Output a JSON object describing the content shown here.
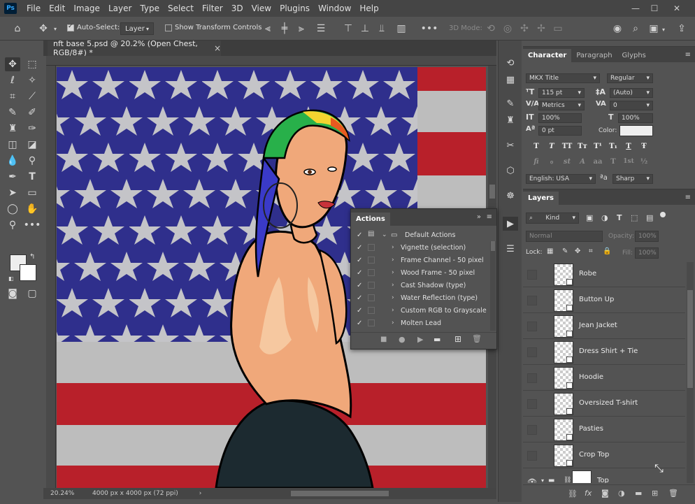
{
  "menubar": {
    "app_logo": "Ps",
    "items": [
      "File",
      "Edit",
      "Image",
      "Layer",
      "Type",
      "Select",
      "Filter",
      "3D",
      "View",
      "Plugins",
      "Window",
      "Help"
    ],
    "window_controls": [
      "—",
      "☐",
      "✕"
    ]
  },
  "options": {
    "auto_select_label": "Auto-Select:",
    "auto_select_checked": true,
    "auto_select_target": "Layer",
    "show_transform_label": "Show Transform Controls",
    "show_transform_checked": false,
    "mode_3d_label": "3D Mode:"
  },
  "document": {
    "tab_title": "nft base 5.psd @ 20.2% (Open Chest, RGB/8#) *",
    "close_glyph": "×",
    "zoom": "20.24%",
    "doc_size": "4000 px x 4000 px (72 ppi)"
  },
  "character": {
    "tabs": [
      "Character",
      "Paragraph",
      "Glyphs"
    ],
    "font_family": "MKX Title",
    "font_style": "Regular",
    "font_size": "115 pt",
    "leading": "(Auto)",
    "kerning": "Metrics",
    "tracking": "0",
    "vertical_scale": "100%",
    "horizontal_scale": "100%",
    "baseline_shift": "0 pt",
    "color_label": "Color:",
    "color_value": "#eeeeee",
    "language": "English: USA",
    "antialias": "Sharp",
    "style_buttons_row1": [
      "T",
      "T",
      "TT",
      "Tт",
      "T¹",
      "T₁",
      "T",
      "Ŧ"
    ],
    "style_buttons_row2": [
      "fi",
      "ℴ",
      "st",
      "A",
      "aa",
      "T",
      "1st",
      "½"
    ]
  },
  "layers": {
    "title": "Layers",
    "filter_kind": "Kind",
    "blend_mode": "Normal",
    "opacity_label": "Opacity:",
    "opacity_value": "100%",
    "lock_label": "Lock:",
    "fill_label": "Fill:",
    "fill_value": "100%",
    "items": [
      {
        "name": "Robe",
        "visible": false
      },
      {
        "name": "Button Up",
        "visible": false
      },
      {
        "name": "Jean Jacket",
        "visible": false
      },
      {
        "name": "Dress Shirt + Tie",
        "visible": false
      },
      {
        "name": "Hoodie",
        "visible": false
      },
      {
        "name": "Oversized T-shirt",
        "visible": false
      },
      {
        "name": "Pasties",
        "visible": false
      },
      {
        "name": "Crop Top",
        "visible": false
      },
      {
        "name": "Top",
        "visible": true,
        "group": true
      }
    ]
  },
  "actions": {
    "title": "Actions",
    "set_name": "Default Actions",
    "items": [
      "Vignette (selection)",
      "Frame Channel - 50 pixel",
      "Wood Frame - 50 pixel",
      "Cast Shadow (type)",
      "Water Reflection (type)",
      "Custom RGB to Grayscale",
      "Molten Lead"
    ]
  },
  "colors": {
    "flag_blue": "#2f2f8c",
    "flag_red": "#b8202a",
    "flag_white": "#bdbdbd",
    "skin": "#f0a87a",
    "skin_light": "#f6c8a0",
    "pants": "#1c2a30"
  }
}
